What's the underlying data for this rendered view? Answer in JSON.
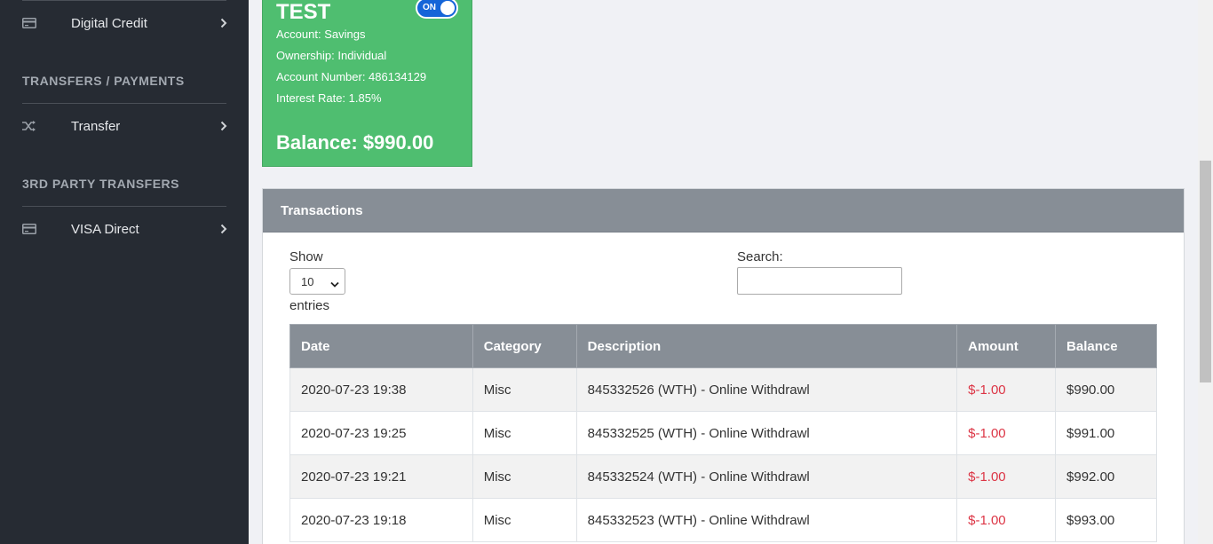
{
  "sidebar": {
    "items": [
      {
        "label": "Digital Credit",
        "icon": "credit-card-icon"
      },
      {
        "label": "Transfer",
        "icon": "shuffle-icon"
      },
      {
        "label": "VISA Direct",
        "icon": "credit-card-icon"
      }
    ],
    "headings": [
      "TRANSFERS / PAYMENTS",
      "3RD PARTY TRANSFERS"
    ]
  },
  "account": {
    "name": "TEST",
    "toggle_label": "ON",
    "toggle_on": true,
    "type_line": "Account: Savings",
    "ownership_line": "Ownership: Individual",
    "number_line": "Account Number: 486134129",
    "rate_line": "Interest Rate: 1.85%",
    "balance_line": "Balance: $990.00"
  },
  "transactions": {
    "title": "Transactions",
    "show_label": "Show",
    "entries_label": "entries",
    "page_length": "10",
    "search_label": "Search:",
    "search_value": "",
    "columns": [
      "Date",
      "Category",
      "Description",
      "Amount",
      "Balance"
    ],
    "rows": [
      [
        "2020-07-23 19:38",
        "Misc",
        "845332526 (WTH) - Online Withdrawl",
        "$-1.00",
        "$990.00"
      ],
      [
        "2020-07-23 19:25",
        "Misc",
        "845332525 (WTH) - Online Withdrawl",
        "$-1.00",
        "$991.00"
      ],
      [
        "2020-07-23 19:21",
        "Misc",
        "845332524 (WTH) - Online Withdrawl",
        "$-1.00",
        "$992.00"
      ],
      [
        "2020-07-23 19:18",
        "Misc",
        "845332523 (WTH) - Online Withdrawl",
        "$-1.00",
        "$993.00"
      ]
    ]
  },
  "colors": {
    "sidebar_bg": "#262b33",
    "card_green": "#4fbe70",
    "header_gray": "#878e96",
    "negative_red": "#dc3545",
    "toggle_blue": "#1565d8"
  }
}
